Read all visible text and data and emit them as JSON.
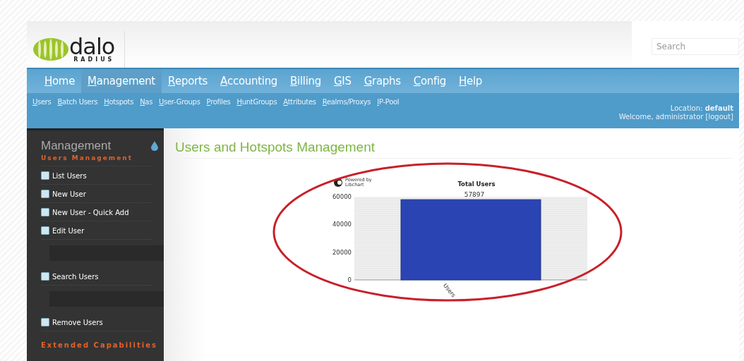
{
  "header": {
    "logo": {
      "word": "dalo",
      "sub": "RADIUS"
    },
    "search": {
      "placeholder": "Search"
    }
  },
  "main_menu": [
    {
      "label": "Home",
      "selected": false
    },
    {
      "label": "Management",
      "selected": true
    },
    {
      "label": "Reports",
      "selected": false
    },
    {
      "label": "Accounting",
      "selected": false
    },
    {
      "label": "Billing",
      "selected": false
    },
    {
      "label": "GIS",
      "selected": false
    },
    {
      "label": "Graphs",
      "selected": false
    },
    {
      "label": "Config",
      "selected": false
    },
    {
      "label": "Help",
      "selected": false
    }
  ],
  "sub_menu": [
    "Users",
    "Batch Users",
    "Hotspots",
    "Nas",
    "User-Groups",
    "Profiles",
    "HuntGroups",
    "Attributes",
    "Realms/Proxys",
    "IP-Pool"
  ],
  "user_info": {
    "location_label": "Location:",
    "location": "default",
    "welcome": "Welcome, administrator",
    "logout": "[logout]"
  },
  "sidebar": {
    "title": "Management",
    "section": "Users Management",
    "items": [
      {
        "kind": "link",
        "label": "List Users"
      },
      {
        "kind": "link",
        "label": "New User"
      },
      {
        "kind": "link",
        "label": "New User - Quick Add"
      },
      {
        "kind": "link",
        "label": "Edit User"
      },
      {
        "kind": "input"
      },
      {
        "kind": "link",
        "label": "Search Users"
      },
      {
        "kind": "input"
      },
      {
        "kind": "link",
        "label": "Remove Users"
      }
    ],
    "next_section": "Extended Capabilities"
  },
  "content": {
    "title": "Users and Hotspots Management",
    "powered_by": [
      "Powered by",
      "Libchart"
    ],
    "chart_data": {
      "type": "bar",
      "title": "Total Users",
      "categories": [
        "Users"
      ],
      "values": [
        57897
      ],
      "ylim": [
        0,
        60000
      ],
      "yticks": [
        0,
        20000,
        40000,
        60000
      ],
      "data_labels": true
    }
  }
}
